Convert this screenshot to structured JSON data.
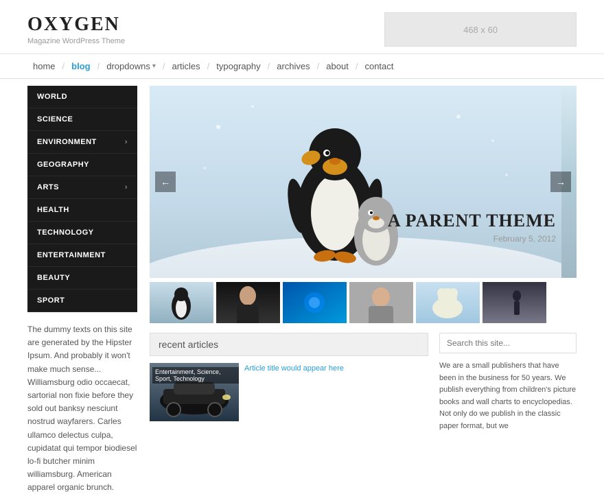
{
  "site": {
    "logo": "OXYGEN",
    "tagline": "Magazine WordPress Theme",
    "ad_size": "468 x 60"
  },
  "nav": {
    "items": [
      {
        "label": "home",
        "active": false,
        "has_sep": false
      },
      {
        "label": "blog",
        "active": true,
        "has_sep": true
      },
      {
        "label": "dropdowns",
        "active": false,
        "has_sep": true,
        "has_arrow": true
      },
      {
        "label": "articles",
        "active": false,
        "has_sep": true
      },
      {
        "label": "typography",
        "active": false,
        "has_sep": true
      },
      {
        "label": "archives",
        "active": false,
        "has_sep": true
      },
      {
        "label": "about",
        "active": false,
        "has_sep": true
      },
      {
        "label": "contact",
        "active": false,
        "has_sep": false
      }
    ]
  },
  "sidebar_menu": {
    "items": [
      {
        "label": "WORLD",
        "has_arrow": false
      },
      {
        "label": "SCIENCE",
        "has_arrow": false
      },
      {
        "label": "ENVIRONMENT",
        "has_arrow": true
      },
      {
        "label": "GEOGRAPHY",
        "has_arrow": false
      },
      {
        "label": "ARTS",
        "has_arrow": true
      },
      {
        "label": "HEALTH",
        "has_arrow": false
      },
      {
        "label": "TECHNOLOGY",
        "has_arrow": false
      },
      {
        "label": "ENTERTAINMENT",
        "has_arrow": false
      },
      {
        "label": "BEAUTY",
        "has_arrow": false
      },
      {
        "label": "SPORT",
        "has_arrow": false
      }
    ]
  },
  "sidebar_text": "The dummy texts on this site are generated by the Hipster Ipsum. And probably it won't make much sense... Williamsburg odio occaecat, sartorial non fixie before they sold out banksy nesciunt nostrud wayfarers. Carles ullamco delectus culpa, cupidatat qui tempor biodiesel lo-fi butcher minim williamsburg. American apparel organic brunch.",
  "hero": {
    "title": "A PARENT THEME",
    "date": "February 5, 2012",
    "prev_btn": "←",
    "next_btn": "→"
  },
  "thumbnails": [
    {
      "alt": "penguin thumb"
    },
    {
      "alt": "woman dark thumb"
    },
    {
      "alt": "blue water thumb"
    },
    {
      "alt": "woman portrait thumb"
    },
    {
      "alt": "polar bear thumb"
    },
    {
      "alt": "person silhouette thumb"
    }
  ],
  "recent_articles": {
    "title": "recent articles",
    "article": {
      "tags": "Entertainment, Science, Sport, Technology",
      "text": ""
    }
  },
  "search": {
    "placeholder": "Search this site..."
  },
  "about_text": "We are a small publishers that have been in the business for 50 years. We publish everything from children's picture books and wall charts to encyclopedias. Not only do we publish in the classic paper format, but we"
}
